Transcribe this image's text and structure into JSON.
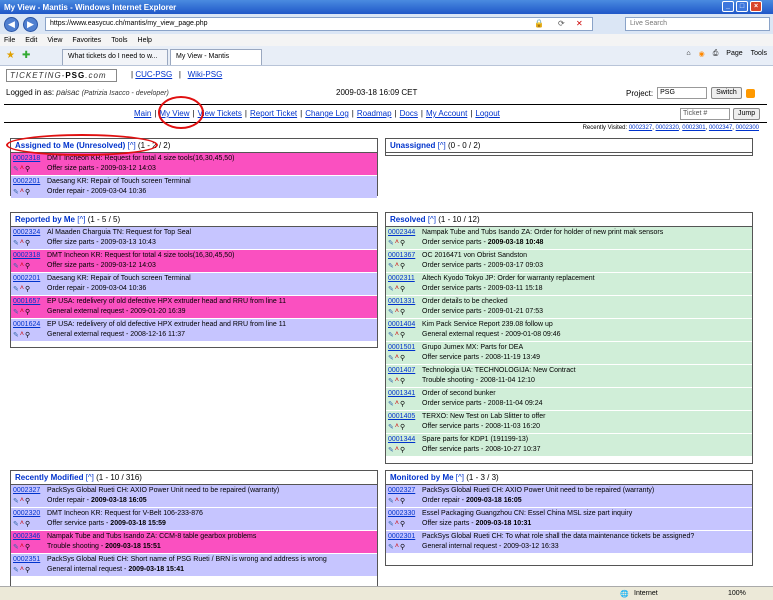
{
  "browser": {
    "title": "My View - Mantis - Windows Internet Explorer",
    "url": "https://www.easycuc.ch/mantis/my_view_page.php",
    "search_placeholder": "Live Search",
    "menu": [
      "File",
      "Edit",
      "View",
      "Favorites",
      "Tools",
      "Help"
    ],
    "tabs": [
      "What tickets do I need to w...",
      "My View - Mantis"
    ],
    "tools": [
      "Page",
      "Tools"
    ],
    "status": "Internet",
    "zoom": "100%"
  },
  "header": {
    "logo_text": "TICKETING-",
    "logo_bold": "PSG",
    "logo_dom": ".com",
    "links": [
      "CUC-PSG",
      "Wiki-PSG"
    ],
    "logged_label": "Logged in as:",
    "username": "paisac",
    "user_full": "(Patrizia Isacco - developer)",
    "datetime": "2009-03-18 16:09 CET",
    "project_label": "Project:",
    "project_value": "PSG",
    "switch": "Switch"
  },
  "menu": {
    "items": [
      "Main",
      "My View",
      "View Tickets",
      "Report Ticket",
      "Change Log",
      "Roadmap",
      "Docs",
      "My Account",
      "Logout"
    ],
    "jump_placeholder": "Ticket #",
    "jump": "Jump"
  },
  "recent": {
    "label": "Recently Visited:",
    "ids": [
      "0002327",
      "0002320",
      "0002301",
      "0002347",
      "0002300"
    ]
  },
  "boxes": {
    "assigned": {
      "title": "Assigned to Me (Unresolved)",
      "nav": "[^]",
      "count": "(1 - 2 / 2)",
      "rows": [
        {
          "id": "0002318",
          "summary": "DMT Incheon KR: Request for total 4 size tools(16,30,45,50)",
          "cat": "Offer size parts",
          "date": "2009-03-12 14:03",
          "color": "pink"
        },
        {
          "id": "0002201",
          "summary": "Daesang KR: Repair of Touch screen Terminal",
          "cat": "Order repair",
          "date": "2009-03-04 10:36",
          "color": "lav"
        }
      ]
    },
    "unassigned": {
      "title": "Unassigned",
      "nav": "[^]",
      "count": "(0 - 0 / 2)",
      "rows": []
    },
    "reported": {
      "title": "Reported by Me",
      "nav": "[^]",
      "count": "(1 - 5 / 5)",
      "rows": [
        {
          "id": "0002324",
          "summary": "Al Maaden Charguia TN: Request for Top Seal",
          "cat": "Offer size parts",
          "date": "2009-03-13 10:43",
          "color": "lav"
        },
        {
          "id": "0002318",
          "summary": "DMT Incheon KR: Request for total 4 size tools(16,30,45,50)",
          "cat": "Offer size parts",
          "date": "2009-03-12 14:03",
          "color": "pink"
        },
        {
          "id": "0002201",
          "summary": "Daesang KR: Repair of Touch screen Terminal",
          "cat": "Order repair",
          "date": "2009-03-04 10:36",
          "color": "lav"
        },
        {
          "id": "0001657",
          "summary": "EP USA: redelivery of old defective HPX extruder head and RRU from line 11",
          "cat": "General external request",
          "date": "2009-01-20 16:39",
          "color": "pink"
        },
        {
          "id": "0001624",
          "summary": "EP USA: redelivery of old defective HPX extruder head and RRU from line 11",
          "cat": "General external request",
          "date": "2008-12-16 11:37",
          "color": "lav"
        }
      ]
    },
    "resolved": {
      "title": "Resolved",
      "nav": "[^]",
      "count": "(1 - 10 / 12)",
      "rows": [
        {
          "id": "0002344",
          "summary": "Nampak Tube and Tubs Isando ZA: Order for holder of new print mak sensors",
          "cat": "Order service parts",
          "date": "2009-03-18 10:48",
          "bold": true
        },
        {
          "id": "0001367",
          "summary": "OC 2016471 von Obrist Sandston",
          "cat": "Order service parts",
          "date": "2009-03-17 09:03"
        },
        {
          "id": "0002311",
          "summary": "Altech Kyodo Tokyo JP: Order for warranty replacement",
          "cat": "Order service parts",
          "date": "2009-03-11 15:18"
        },
        {
          "id": "0001331",
          "summary": "Order details to be checked",
          "cat": "Order service parts",
          "date": "2009-01-21 07:53"
        },
        {
          "id": "0001404",
          "summary": "Kim Pack Service Report 239.08 follow up",
          "cat": "General external request",
          "date": "2009-01-08 09:46"
        },
        {
          "id": "0001501",
          "summary": "Grupo Jumex MX: Parts for DEA",
          "cat": "Offer service parts",
          "date": "2008-11-19 13:49"
        },
        {
          "id": "0001407",
          "summary": "Technologia UA: TECHNOLOGIJA: New Contract",
          "cat": "Trouble shooting",
          "date": "2008-11-04 12:10"
        },
        {
          "id": "0001341",
          "summary": "Order of second bunker",
          "cat": "Order service parts",
          "date": "2008-11-04 09:24"
        },
        {
          "id": "0001405",
          "summary": "TERXO: New Test on Lab Slitter to offer",
          "cat": "Offer service parts",
          "date": "2008-11-03 16:20"
        },
        {
          "id": "0001344",
          "summary": "Spare parts for KDP1 (191199-13)",
          "cat": "Offer service parts",
          "date": "2008-10-27 10:37"
        }
      ]
    },
    "modified": {
      "title": "Recently Modified",
      "nav": "[^]",
      "count": "(1 - 10 / 316)",
      "rows": [
        {
          "id": "0002327",
          "summary": "PackSys Global Rueti CH: AXIO Power Unit need to be repaired (warranty)",
          "cat": "Order repair",
          "date": "2009-03-18 16:05",
          "color": "lav",
          "bold": true
        },
        {
          "id": "0002320",
          "summary": "DMT Incheon KR: Request for V-Belt 106-233-876",
          "cat": "Offer service parts",
          "date": "2009-03-18 15:59",
          "color": "lav",
          "bold": true
        },
        {
          "id": "0002346",
          "summary": "Nampak Tube and Tubs Isando ZA: CCM-8 table gearbox problems",
          "cat": "Trouble shooting",
          "date": "2009-03-18 15:51",
          "color": "pink",
          "bold": true
        },
        {
          "id": "0002351",
          "summary": "PackSys Global Rueti CH: Short name of PSG Rueti / BRN is wrong and address is wrong",
          "cat": "General internal request",
          "date": "2009-03-18 15:41",
          "color": "lav",
          "bold": true
        }
      ]
    },
    "monitored": {
      "title": "Monitored by Me",
      "nav": "[^]",
      "count": "(1 - 3 / 3)",
      "rows": [
        {
          "id": "0002327",
          "summary": "PackSys Global Rueti CH: AXIO Power Unit need to be repaired (warranty)",
          "cat": "Order repair",
          "date": "2009-03-18 16:05",
          "color": "lav",
          "bold": true
        },
        {
          "id": "0002330",
          "summary": "Essel Packaging Guangzhou CN: Essel China MSL size part inquiry",
          "cat": "Offer size parts",
          "date": "2009-03-18 10:31",
          "color": "lav",
          "bold": true
        },
        {
          "id": "0002301",
          "summary": "PackSys Global Rueti CH: To what role shall the data maintenance tickets be assigned?",
          "cat": "General internal request",
          "date": "2009-03-12 16:33",
          "color": "lav"
        }
      ]
    }
  }
}
